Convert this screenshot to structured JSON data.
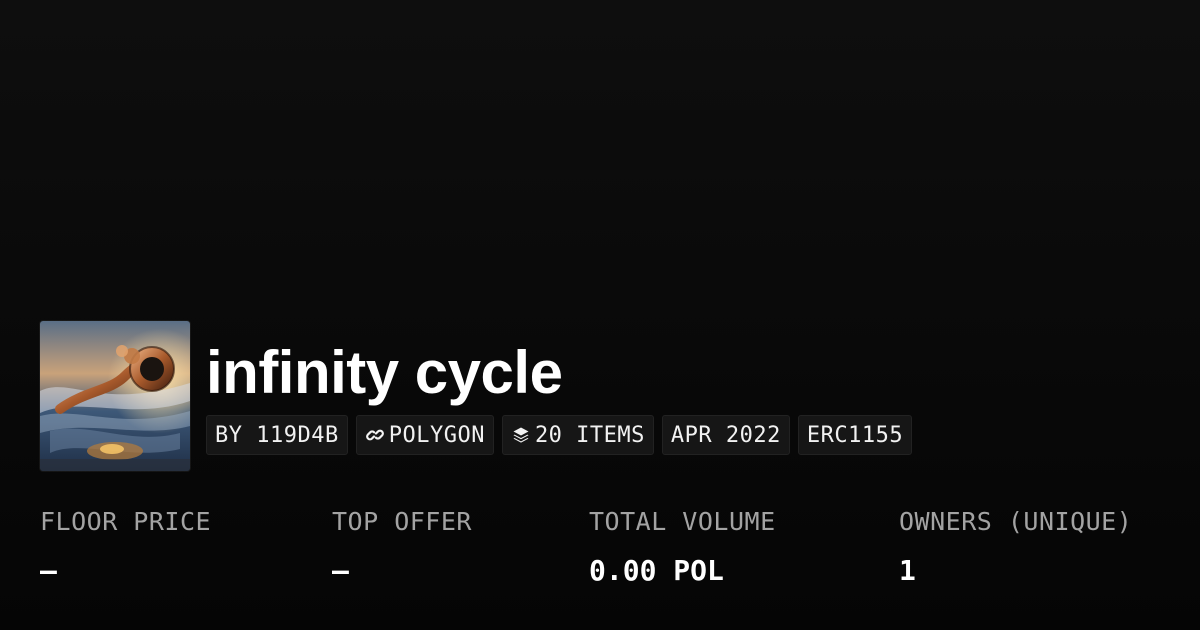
{
  "collection": {
    "title": "infinity cycle",
    "thumbnail_icon": "collection-artwork"
  },
  "tags": {
    "creator": "BY 119D4B",
    "chain": "POLYGON",
    "chain_icon": "polygon-link-icon",
    "items": "20 ITEMS",
    "items_icon": "layers-icon",
    "date": "APR 2022",
    "standard": "ERC1155"
  },
  "stats": {
    "floor_price": {
      "label": "FLOOR PRICE",
      "value": "–"
    },
    "top_offer": {
      "label": "TOP OFFER",
      "value": "–"
    },
    "total_volume": {
      "label": "TOTAL VOLUME",
      "value": "0.00 POL"
    },
    "owners": {
      "label": "OWNERS (UNIQUE)",
      "value": "1"
    }
  },
  "colors": {
    "background": "#0a0a0a",
    "text_primary": "#ffffff",
    "text_secondary": "#a3a3a3",
    "tag_background": "#161616"
  }
}
